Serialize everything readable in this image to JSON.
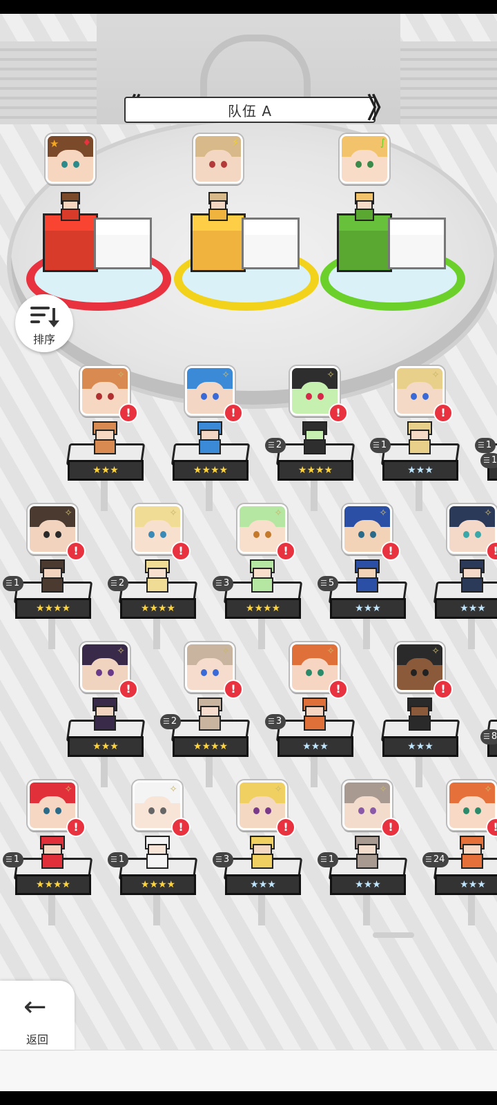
{
  "team": {
    "title": "队伍 A",
    "prev": "《",
    "next": "》"
  },
  "sort": {
    "label": "排序",
    "icon": "sort-icon"
  },
  "back": {
    "label": "返回",
    "icon": "back-arrow-icon"
  },
  "team_slots": [
    {
      "id": "slot1",
      "element_icon": "fire-element-icon",
      "leader": true,
      "hair": "#7a4a2a",
      "skin": "#f6d6be",
      "eyes": "#2c8a8a",
      "block": "#d83b2a",
      "ring": "#e8323f"
    },
    {
      "id": "slot2",
      "element_icon": "lightning-element-icon",
      "leader": false,
      "hair": "#d8b98a",
      "skin": "#f4d7c3",
      "eyes": "#b43a3a",
      "block": "#f0b33e",
      "ring": "#f2d21a"
    },
    {
      "id": "slot3",
      "element_icon": "wind-element-icon",
      "leader": false,
      "hair": "#f2c36a",
      "skin": "#f8dcc7",
      "eyes": "#3a8a4a",
      "block": "#5aa832",
      "ring": "#6bd12a"
    }
  ],
  "roster": [
    {
      "row": 0,
      "col": 0,
      "count": "",
      "stars": "★★★",
      "tier": "gold",
      "hair": "#d88a50",
      "skin": "#f6d8c2",
      "eyes": "#b03030"
    },
    {
      "row": 0,
      "col": 1,
      "count": "",
      "stars": "★★★★",
      "tier": "gold",
      "hair": "#3a8ad8",
      "skin": "#f3d6c4",
      "eyes": "#3a6ad8"
    },
    {
      "row": 0,
      "col": 2,
      "count": "2",
      "stars": "★★★★",
      "tier": "gold",
      "hair": "#2e2e2e",
      "skin": "#c6f0b0",
      "eyes": "#d8284a"
    },
    {
      "row": 0,
      "col": 3,
      "count": "1",
      "stars": "★★★",
      "tier": "silver",
      "hair": "#e8cf8a",
      "skin": "#f3d9c6",
      "eyes": "#3a6ad8"
    },
    {
      "row": 0,
      "col": 4,
      "count": "1",
      "stars": "★★★",
      "tier": "silver",
      "hair": "#4a3a36",
      "skin": "#f3dac8",
      "eyes": "#2a6b8a"
    },
    {
      "row": 1,
      "col": 0,
      "count": "1",
      "stars": "★★★★",
      "tier": "gold",
      "hair": "#4a3a30",
      "skin": "#f2d4be",
      "eyes": "#2a2a2a"
    },
    {
      "row": 1,
      "col": 1,
      "count": "2",
      "stars": "★★★★",
      "tier": "gold",
      "hair": "#f1dc96",
      "skin": "#f8e0cf",
      "eyes": "#3a8ab8"
    },
    {
      "row": 1,
      "col": 2,
      "count": "3",
      "stars": "★★★★",
      "tier": "gold",
      "hair": "#b5e6a2",
      "skin": "#f7dfcc",
      "eyes": "#c47a2a"
    },
    {
      "row": 1,
      "col": 3,
      "count": "5",
      "stars": "★★★",
      "tier": "silver",
      "hair": "#2c4fa6",
      "skin": "#f3d3b8",
      "eyes": "#2a6b8a"
    },
    {
      "row": 1,
      "col": 4,
      "count": "",
      "stars": "★★★",
      "tier": "silver",
      "hair": "#2c3a5a",
      "skin": "#f4d8c8",
      "eyes": "#3aa8a8"
    },
    {
      "row": 2,
      "col": 0,
      "count": "",
      "stars": "★★★",
      "tier": "gold",
      "hair": "#3a2a4a",
      "skin": "#f1d4c0",
      "eyes": "#6a3a8a"
    },
    {
      "row": 2,
      "col": 1,
      "count": "2",
      "stars": "★★★★",
      "tier": "gold",
      "hair": "#c9b4a0",
      "skin": "#f6dccc",
      "eyes": "#3a6ad8"
    },
    {
      "row": 2,
      "col": 2,
      "count": "3",
      "stars": "★★★",
      "tier": "silver",
      "hair": "#e0703a",
      "skin": "#f6d6c2",
      "eyes": "#2a8a6a"
    },
    {
      "row": 2,
      "col": 3,
      "count": "",
      "stars": "★★★",
      "tier": "silver",
      "hair": "#2a2a2a",
      "skin": "#8a5a3a",
      "eyes": "#222222"
    },
    {
      "row": 2,
      "col": 4,
      "count": "",
      "stars": "★★★",
      "tier": "silver",
      "hair": "#f0f0f0",
      "skin": "#f7ece4",
      "eyes": "#888888"
    },
    {
      "row": 3,
      "col": 0,
      "count": "1",
      "stars": "★★★★",
      "tier": "gold",
      "hair": "#e2303a",
      "skin": "#f6d7c3",
      "eyes": "#2a6b8a"
    },
    {
      "row": 3,
      "col": 1,
      "count": "1",
      "stars": "★★★★",
      "tier": "gold",
      "hair": "#f4f4f4",
      "skin": "#f9e4d8",
      "eyes": "#666666"
    },
    {
      "row": 3,
      "col": 2,
      "count": "3",
      "stars": "★★★",
      "tier": "silver",
      "hair": "#f0d060",
      "skin": "#f5d8c2",
      "eyes": "#7a3a8a"
    },
    {
      "row": 3,
      "col": 3,
      "count": "1",
      "stars": "★★★",
      "tier": "silver",
      "hair": "#a89a90",
      "skin": "#f4dccd",
      "eyes": "#8a5aa8"
    },
    {
      "row": 3,
      "col": 4,
      "count": "24",
      "stars": "★★★",
      "tier": "silver",
      "hair": "#e6703a",
      "skin": "#f7d9c5",
      "eyes": "#2a8a6a"
    }
  ],
  "edge_counts": {
    "row0_right": "1",
    "row2_right": "8"
  }
}
